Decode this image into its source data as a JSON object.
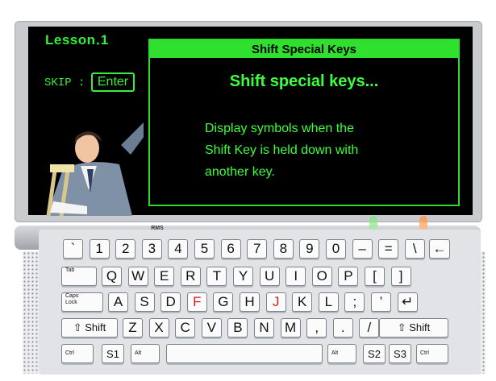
{
  "lesson": {
    "title": "Lesson․1"
  },
  "skip": {
    "label": "SKIP  :",
    "enter_label": "Enter"
  },
  "panel": {
    "header": "Shift Special Keys",
    "heading": "Shift special keys...",
    "body": [
      "Display symbols when the",
      "Shift Key is held down with",
      "another key."
    ]
  },
  "device": {
    "brand": "RMS"
  },
  "keyboard": {
    "row1": [
      "`",
      "1",
      "2",
      "3",
      "4",
      "5",
      "6",
      "7",
      "8",
      "9",
      "0",
      "–",
      "=",
      "\\",
      "←"
    ],
    "row2_tab": "Tab",
    "row2": [
      "Q",
      "W",
      "E",
      "R",
      "T",
      "Y",
      "U",
      "I",
      "O",
      "P",
      "[",
      "]"
    ],
    "row3_caps": [
      "Caps",
      "Lock"
    ],
    "row3": [
      "A",
      "S",
      "D",
      "F",
      "G",
      "H",
      "J",
      "K",
      "L",
      ";",
      "’",
      "↵"
    ],
    "row4_shift": "⇧ Shift",
    "row4": [
      "Z",
      "X",
      "C",
      "V",
      "B",
      "N",
      "M",
      ",",
      ".",
      "/"
    ],
    "row4_shift_r": "⇧ Shift",
    "row5": {
      "ctrl_l": "Ctrl",
      "s1": "S1",
      "alt_l": "Alt",
      "space": "",
      "alt_r": "Alt",
      "s2": "S2",
      "s3": "S3",
      "ctrl_r": "Ctrl"
    },
    "highlighted_keys": [
      "F",
      "J"
    ],
    "highlight_color": "#d81e1e"
  },
  "colors": {
    "screen_green": "#34f038",
    "panel_header": "#2fe02f",
    "screen_bg": "#000000"
  }
}
